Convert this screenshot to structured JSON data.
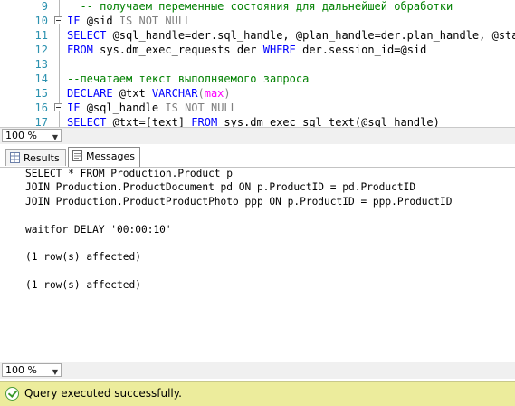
{
  "editor": {
    "lines": [
      {
        "num": "9",
        "collapse": false,
        "spans": [
          {
            "t": "  ",
            "c": ""
          },
          {
            "t": "-- получаем переменные состояния для дальнейшей обработки",
            "c": "cm"
          }
        ]
      },
      {
        "num": "10",
        "collapse": true,
        "spans": [
          {
            "t": "IF ",
            "c": "kw"
          },
          {
            "t": "@sid ",
            "c": ""
          },
          {
            "t": "IS NOT NULL",
            "c": "gr"
          }
        ]
      },
      {
        "num": "11",
        "collapse": false,
        "spans": [
          {
            "t": "SELECT ",
            "c": "kw"
          },
          {
            "t": "@sql_handle=der.sql_handle, @plan_handle=der.plan_handle, @state",
            "c": ""
          }
        ]
      },
      {
        "num": "12",
        "collapse": false,
        "spans": [
          {
            "t": "FROM ",
            "c": "kw"
          },
          {
            "t": "sys.dm_exec_requests der ",
            "c": ""
          },
          {
            "t": "WHERE ",
            "c": "kw"
          },
          {
            "t": "der.session_id=@sid",
            "c": ""
          }
        ]
      },
      {
        "num": "13",
        "collapse": false,
        "spans": []
      },
      {
        "num": "14",
        "collapse": false,
        "spans": [
          {
            "t": "--печатаем текст выполняемого запроса",
            "c": "cm"
          }
        ]
      },
      {
        "num": "15",
        "collapse": false,
        "spans": [
          {
            "t": "DECLARE ",
            "c": "kw"
          },
          {
            "t": "@txt ",
            "c": ""
          },
          {
            "t": "VARCHAR",
            "c": "kw"
          },
          {
            "t": "(",
            "c": "gr"
          },
          {
            "t": "max",
            "c": "fn"
          },
          {
            "t": ")",
            "c": "gr"
          }
        ]
      },
      {
        "num": "16",
        "collapse": true,
        "spans": [
          {
            "t": "IF ",
            "c": "kw"
          },
          {
            "t": "@sql_handle ",
            "c": ""
          },
          {
            "t": "IS NOT NULL",
            "c": "gr"
          }
        ]
      },
      {
        "num": "17",
        "collapse": false,
        "spans": [
          {
            "t": "SELECT ",
            "c": "kw"
          },
          {
            "t": "@txt=[text] ",
            "c": ""
          },
          {
            "t": "FROM ",
            "c": "kw"
          },
          {
            "t": "sys.dm_exec_sql_text(@sql_handle)",
            "c": ""
          }
        ]
      }
    ]
  },
  "zoom_top": {
    "value": "100 %"
  },
  "zoom_bottom": {
    "value": "100 %"
  },
  "tabs": {
    "results": "Results",
    "messages": "Messages"
  },
  "messages": [
    "SELECT * FROM Production.Product p",
    "JOIN Production.ProductDocument pd ON p.ProductID = pd.ProductID",
    "JOIN Production.ProductProductPhoto ppp ON p.ProductID = ppp.ProductID",
    "",
    "waitfor DELAY '00:00:10'",
    "",
    "(1 row(s) affected)",
    "",
    "(1 row(s) affected)"
  ],
  "status": {
    "text": "Query executed successfully."
  }
}
